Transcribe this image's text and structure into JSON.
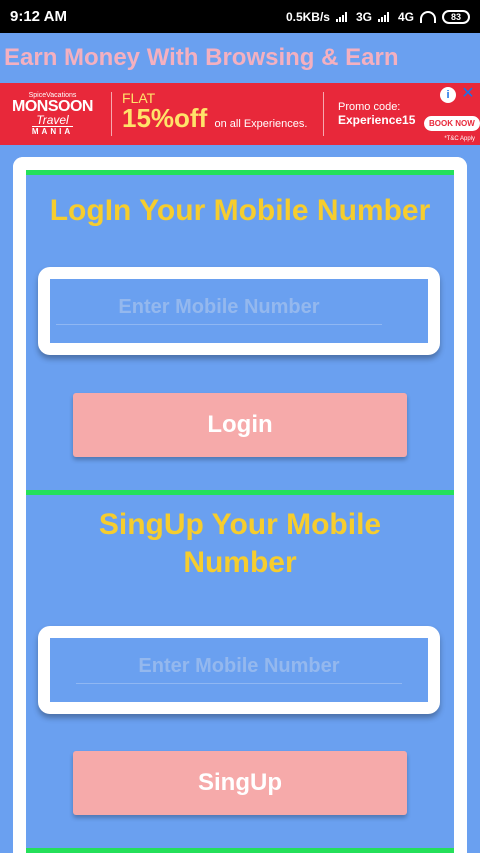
{
  "status_bar": {
    "time": "9:12 AM",
    "net_speed": "0.5KB/s",
    "net1": "3G",
    "net2": "4G",
    "net2_suffix": "₀",
    "battery": "83"
  },
  "app_bar": {
    "title": "Earn Money With Browsing & Earn"
  },
  "ad": {
    "brand": "SpiceVacations",
    "logo_line1": "MONSOON",
    "logo_line2": "Travel",
    "logo_line3": "MANIA",
    "flat": "FLAT",
    "offer": "15%off",
    "offer_suffix": "on all Experiences.",
    "promo_label": "Promo code:",
    "promo_code": "Experience15",
    "book_now": "BOOK NOW",
    "tc": "*T&C Apply",
    "choices_icon": "i",
    "close_icon": "✕",
    "color": "#e8283a"
  },
  "login": {
    "title": "LogIn Your Mobile Number",
    "placeholder": "Enter Mobile Number",
    "button": "Login"
  },
  "signup": {
    "title_line1": "SingUp Your Mobile",
    "title_line2": "Number",
    "placeholder": "Enter Mobile Number",
    "button": "SingUp"
  },
  "colors": {
    "background": "#6aa0f0",
    "title": "#f6cd2e",
    "button": "#f6aaaa",
    "divider": "#24e05a",
    "app_title": "#f4b0c0"
  }
}
